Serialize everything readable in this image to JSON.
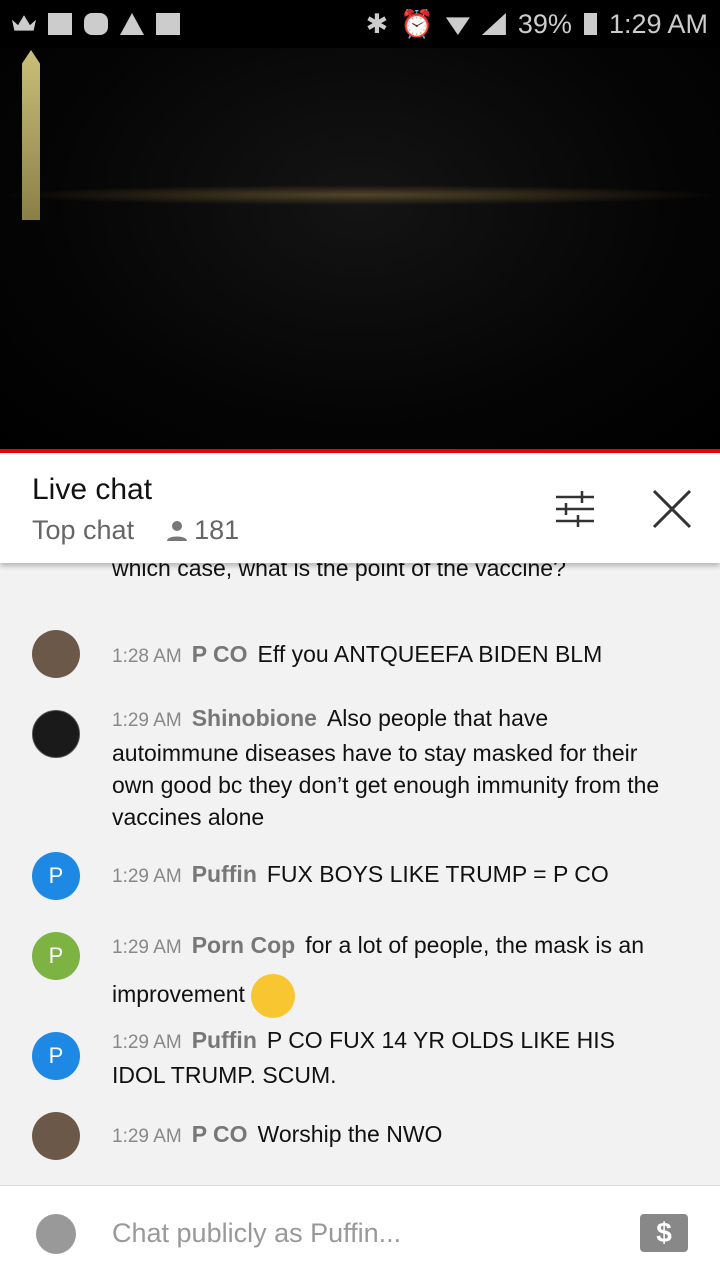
{
  "status_bar": {
    "battery": "39%",
    "time": "1:29 AM",
    "icons_left": [
      "crown-icon",
      "folder-icon",
      "m-app-icon",
      "warning-icon",
      "image-icon"
    ],
    "icons_right": [
      "bluetooth-icon",
      "alarm-icon",
      "wifi-icon",
      "signal-icon",
      "battery-icon"
    ]
  },
  "header": {
    "title": "Live chat",
    "mode": "Top chat",
    "viewers": "181"
  },
  "messages": [
    {
      "time": "",
      "author": "",
      "text": "Unless you're saying it doesn't make you immune. In which case, what is the point of the vaccine?",
      "avatar_color": "#444c55",
      "initial": ""
    },
    {
      "time": "1:28 AM",
      "author": "P CO",
      "text": "Eff you ANTQUEEFA BIDEN BLM",
      "avatar_color": "#6b5848",
      "initial": ""
    },
    {
      "time": "1:29 AM",
      "author": "Shinobione",
      "text": "Also people that have autoimmune diseases have to stay masked for their own good bc they don’t get enough immunity from the vaccines alone",
      "avatar_color": "#1a1a1a",
      "initial": ""
    },
    {
      "time": "1:29 AM",
      "author": "Puffin",
      "text": "FUX BOYS LIKE TRUMP = P CO",
      "avatar_color": "#1e88e5",
      "initial": "P"
    },
    {
      "time": "1:29 AM",
      "author": "Porn Cop",
      "text": "for a lot of people, the mask is an improvement",
      "avatar_color": "#7cb342",
      "initial": "P",
      "emoji": "smirking-face"
    },
    {
      "time": "1:29 AM",
      "author": "Puffin",
      "text": "P CO FUX 14 YR OLDS LIKE HIS IDOL TRUMP. SCUM.",
      "avatar_color": "#1e88e5",
      "initial": "P"
    },
    {
      "time": "1:29 AM",
      "author": "P CO",
      "text": "Worship the NWO",
      "avatar_color": "#6b5848",
      "initial": ""
    }
  ],
  "input": {
    "placeholder": "Chat publicly as Puffin..."
  },
  "colors": {
    "progress": "#e00000",
    "accent": "#1e88e5"
  }
}
